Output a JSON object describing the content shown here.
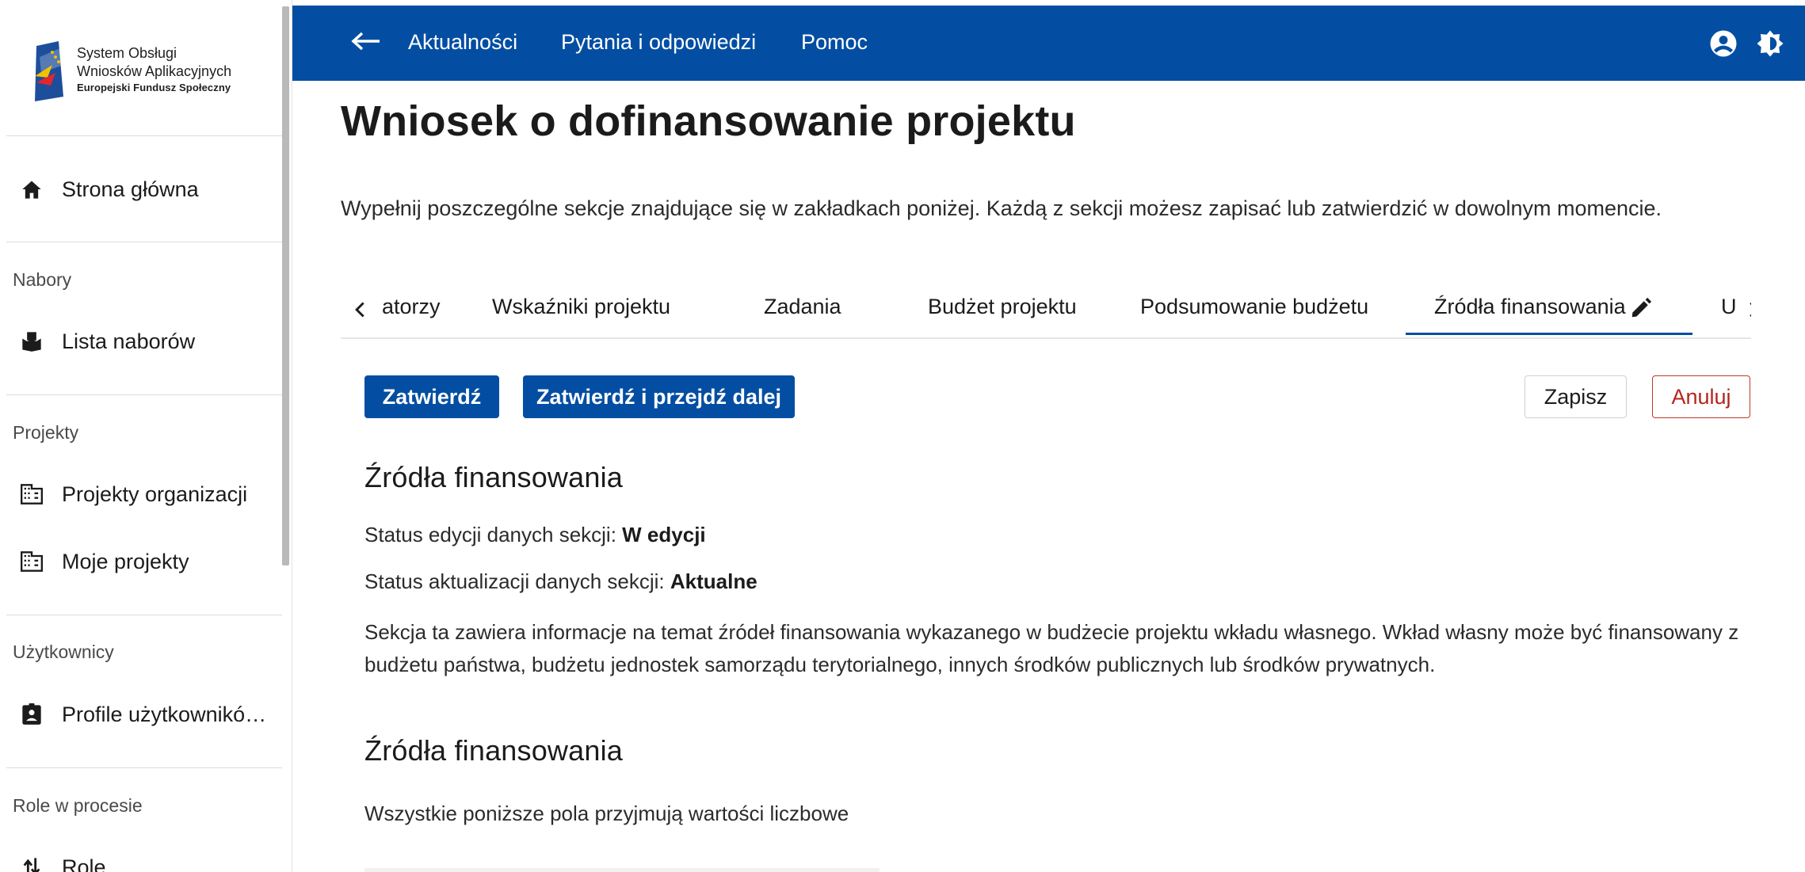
{
  "sidebar": {
    "brand": {
      "line1": "System Obsługi",
      "line2": "Wniosków Aplikacyjnych",
      "line3": "Europejski Fundusz Społeczny"
    },
    "home": "Strona główna",
    "sections": [
      {
        "heading": "Nabory",
        "items": [
          {
            "label": "Lista naborów",
            "icon": "ballot-box-icon"
          }
        ]
      },
      {
        "heading": "Projekty",
        "items": [
          {
            "label": "Projekty organizacji",
            "icon": "building-icon"
          },
          {
            "label": "Moje projekty",
            "icon": "building-icon"
          }
        ]
      },
      {
        "heading": "Użytkownicy",
        "items": [
          {
            "label": "Profile użytkownikó…",
            "icon": "badge-icon"
          }
        ]
      },
      {
        "heading": "Role w procesie",
        "items": [
          {
            "label": "Role",
            "icon": "swap-icon"
          }
        ]
      }
    ]
  },
  "topbar": {
    "links": [
      "Aktualności",
      "Pytania i odpowiedzi",
      "Pomoc"
    ],
    "icons": [
      "account-circle-icon",
      "brightness-contrast-icon"
    ],
    "color": "#034ea2"
  },
  "main": {
    "title": "Wniosek o dofinansowanie projektu",
    "intro": "Wypełnij poszczególne sekcje znajdujące się w zakładkach poniżej. Każdą z sekcji możesz zapisać lub zatwierdzić w dowolnym momencie.",
    "tabs": [
      "atorzy",
      "Wskaźniki projektu",
      "Zadania",
      "Budżet projektu",
      "Podsumowanie budżetu",
      "Źródła finansowania",
      "U"
    ],
    "active_tab": "Źródła finansowania",
    "buttons": {
      "confirm": "Zatwierdź",
      "confirm_next": "Zatwierdź i przejdź dalej",
      "save": "Zapisz",
      "cancel": "Anuluj"
    },
    "section_title": "Źródła finansowania",
    "status_edit_label": "Status edycji danych sekcji:",
    "status_edit_value": "W edycji",
    "status_update_label": "Status aktualizacji danych sekcji:",
    "status_update_value": "Aktualne",
    "description": "Sekcja ta zawiera informacje na temat źródeł finansowania wykazanego w budżecie projektu wkładu własnego. Wkład własny może być finansowany z budżetu państwa, budżetu jednostek samorządu terytorialnego, innych środków publicznych lub środków prywatnych.",
    "subsection_title": "Źródła finansowania",
    "subsection_note": "Wszystkie poniższe pola przyjmują wartości liczbowe"
  }
}
